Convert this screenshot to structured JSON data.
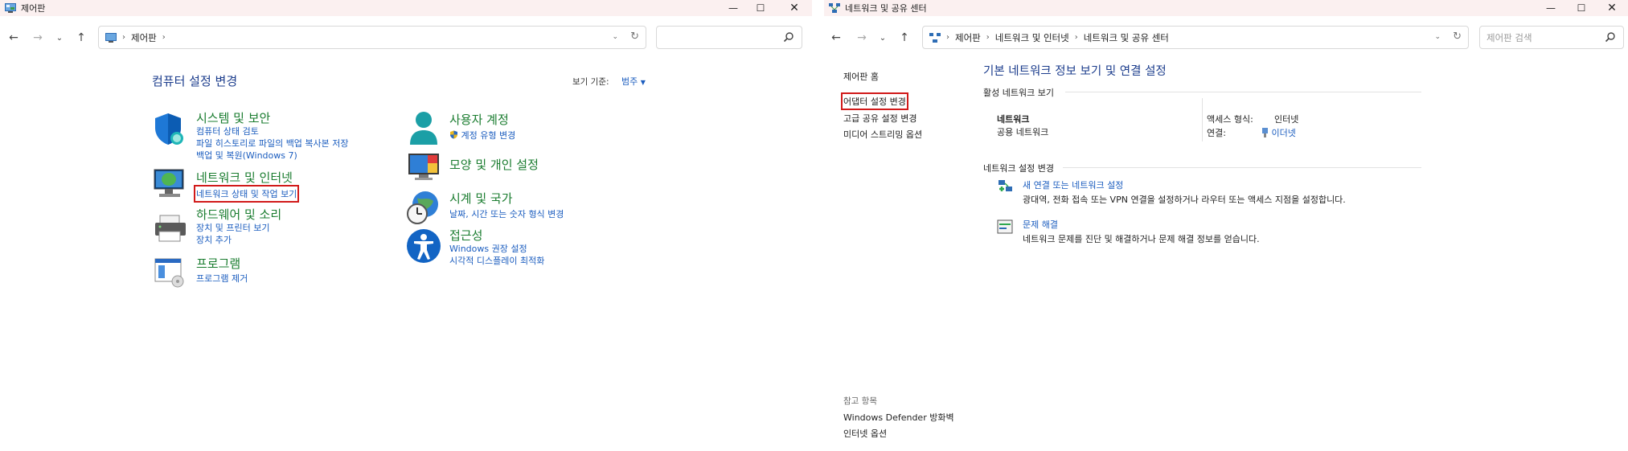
{
  "left": {
    "title": "제어판",
    "breadcrumb": [
      "제어판"
    ],
    "heading": "컴퓨터 설정 변경",
    "view_by_label": "보기 기준:",
    "view_by_value": "범주",
    "categories": [
      {
        "title": "시스템 및 보안",
        "links": [
          "컴퓨터 상태 검토",
          "파일 히스토리로 파일의 백업 복사본 저장",
          "백업 및 복원(Windows 7)"
        ]
      },
      {
        "title": "네트워크 및 인터넷",
        "links": [
          "네트워크 상태 및 작업 보기"
        ]
      },
      {
        "title": "하드웨어 및 소리",
        "links": [
          "장치 및 프린터 보기",
          "장치 추가"
        ]
      },
      {
        "title": "프로그램",
        "links": [
          "프로그램 제거"
        ]
      },
      {
        "title": "사용자 계정",
        "links": [
          "계정 유형 변경"
        ]
      },
      {
        "title": "모양 및 개인 설정",
        "links": []
      },
      {
        "title": "시계 및 국가",
        "links": [
          "날짜, 시간 또는 숫자 형식 변경"
        ]
      },
      {
        "title": "접근성",
        "links": [
          "Windows 권장 설정",
          "시각적 디스플레이 최적화"
        ]
      }
    ]
  },
  "right": {
    "title": "네트워크 및 공유 센터",
    "breadcrumb": [
      "제어판",
      "네트워크 및 인터넷",
      "네트워크 및 공유 센터"
    ],
    "search_placeholder": "제어판 검색",
    "side_links": [
      "제어판 홈",
      "어댑터 설정 변경",
      "고급 공유 설정 변경",
      "미디어 스트리밍 옵션"
    ],
    "see_also_label": "참고 항목",
    "see_also": [
      "Windows Defender 방화벽",
      "인터넷 옵션"
    ],
    "heading": "기본 네트워크 정보 보기 및 연결 설정",
    "active_networks_label": "활성 네트워크 보기",
    "network_name": "네트워크",
    "network_type": "공용 네트워크",
    "access_type_label": "액세스 형식:",
    "access_type_value": "인터넷",
    "connections_label": "연결:",
    "connections_value": "이더넷",
    "change_settings_label": "네트워크 설정 변경",
    "new_connection_title": "새 연결 또는 네트워크 설정",
    "new_connection_desc": "광대역, 전화 접속 또는 VPN 연결을 설정하거나 라우터 또는 액세스 지점을 설정합니다.",
    "troubleshoot_title": "문제 해결",
    "troubleshoot_desc": "네트워크 문제를 진단 및 해결하거나 문제 해결 정보를 얻습니다."
  },
  "colors": {
    "link": "#1b5dbf",
    "category": "#1a7c2f",
    "highlight": "#d11a1a"
  }
}
